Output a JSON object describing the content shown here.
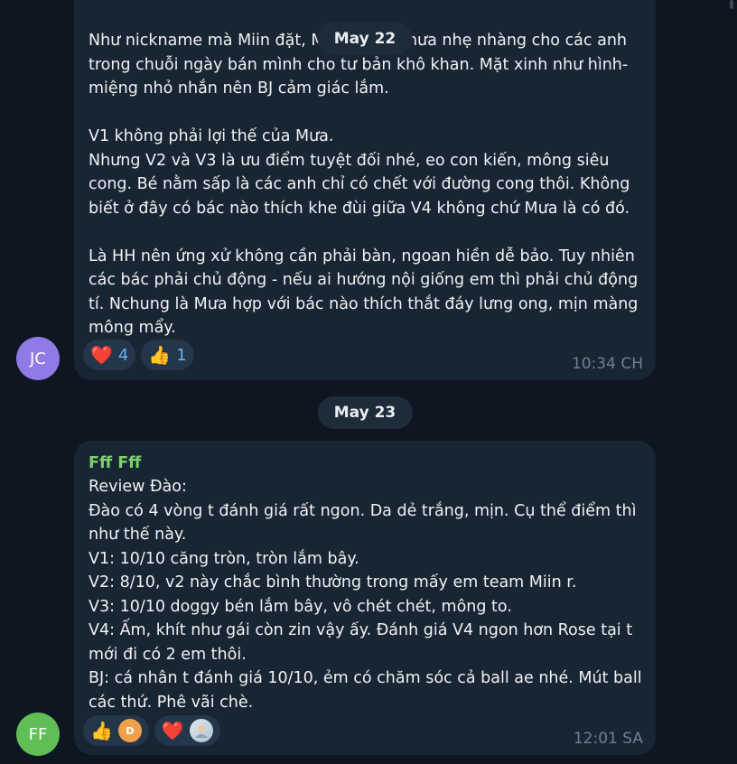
{
  "messages": [
    {
      "avatar_initials": "JC",
      "avatar_color": "#8f7ae6",
      "text": "Như nickname mà Miin đặt, Mưa là cơn mưa nhẹ nhàng cho các anh trong chuỗi ngày bán mình cho tư bản khô khan. Mặt xinh như hình- miệng nhỏ nhắn nên BJ cảm giác lắm.\n\nV1 không phải lợi thế của Mưa.\nNhưng V2 và V3 là ưu điểm tuyệt đối nhé, eo con kiến, mông siêu cong. Bé nằm sấp là các anh chỉ có chết với đường cong thôi. Không biết ở đây có bác nào thích khe đùi giữa V4 không chứ Mưa là có đó.\n\nLà HH nên ứng xử không cần phải bàn, ngoan hiền dễ bảo. Tuy nhiên các bác phải chủ động - nếu ai hướng nội giống em thì phải chủ động tí. Nchung là Mưa hợp với bác nào thích thắt đáy lưng ong, mịn màng mông mẩy.",
      "reactions": [
        {
          "emoji": "❤️",
          "icon": "heart-icon",
          "count": "4"
        },
        {
          "emoji": "👍",
          "icon": "thumbs-up-icon",
          "count": "1"
        }
      ],
      "time": "10:34 CH"
    },
    {
      "avatar_initials": "FF",
      "avatar_color": "#5fbf55",
      "sender": "Fff Fff",
      "sender_color": "#7bd16e",
      "text": "Review Đào:\nĐào có 4 vòng t đánh giá rất ngon. Da dẻ trắng, mịn. Cụ thể điểm thì như thế này.\nV1: 10/10 căng tròn, tròn lắm bây.\nV2: 8/10, v2 này chắc bình thường trong mấy em team Miin r.\nV3: 10/10 doggy bén lắm bây, vô chét chét, mông to.\nV4: Ấm, khít như gái còn zin vậy ấy. Đánh giá V4 ngon hơn Rose tại t mới đi có 2 em thôi.\nBJ: cá nhân t đánh giá 10/10, ẻm có chăm sóc cả ball ae nhé. Mút ball các thứ. Phê vãi chè.",
      "reactions": [
        {
          "emoji": "👍",
          "icon": "thumbs-up-icon",
          "reactor_initial": "D",
          "reactor_color": "#f0a04b"
        },
        {
          "emoji": "❤️",
          "icon": "heart-icon",
          "reactor_initial": "",
          "reactor_color": "#c9d6e0"
        }
      ],
      "time": "12:01 SA"
    }
  ],
  "date_separators": [
    "May 22",
    "May 23"
  ]
}
